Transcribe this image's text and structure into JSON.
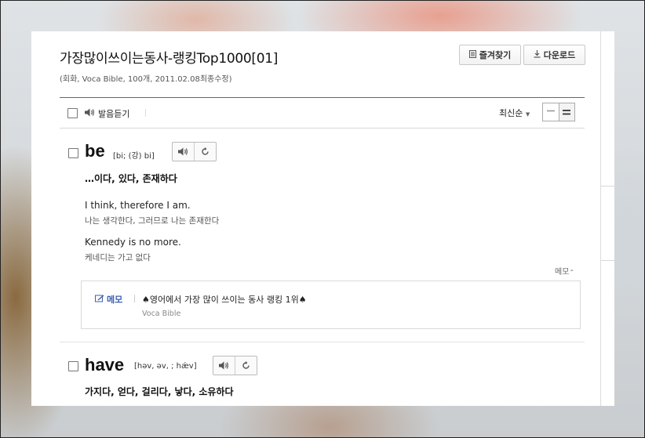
{
  "header": {
    "title": "가장많이쓰이는동사-랭킹Top1000[01]",
    "meta": "(회화, Voca Bible, 100개, 2011.02.08최종수정)",
    "favorite_label": "즐겨찾기",
    "download_label": "다운로드"
  },
  "toolbar": {
    "listen_label": "발음듣기",
    "sort_label": "최신순"
  },
  "entries": [
    {
      "word": "be",
      "pron": "[bi; (강) bi]",
      "meaning": "…이다, 있다, 존재하다",
      "examples": [
        {
          "en": "I think, therefore I am.",
          "ko": "나는 생각한다, 그러므로 나는 존재한다"
        },
        {
          "en": "Kennedy is no more.",
          "ko": "케네디는 가고 없다"
        }
      ],
      "memo_toggle": "메모",
      "memo_label": "메모",
      "memo_text": "♠영어에서 가장 많이 쓰이는 동사 랭킹 1위♠",
      "memo_source": "Voca Bible"
    },
    {
      "word": "have",
      "pron": "[həv, əv, ; hǽv]",
      "meaning": "가지다, 얻다, 걸리다, 낳다, 소유하다"
    }
  ],
  "icons": {
    "speaker": "speaker-icon",
    "repeat": "repeat-icon",
    "bookmark": "bookmark-icon",
    "download": "download-icon",
    "pencil": "pencil-icon"
  },
  "colors": {
    "memo_accent": "#3b5fb0"
  }
}
